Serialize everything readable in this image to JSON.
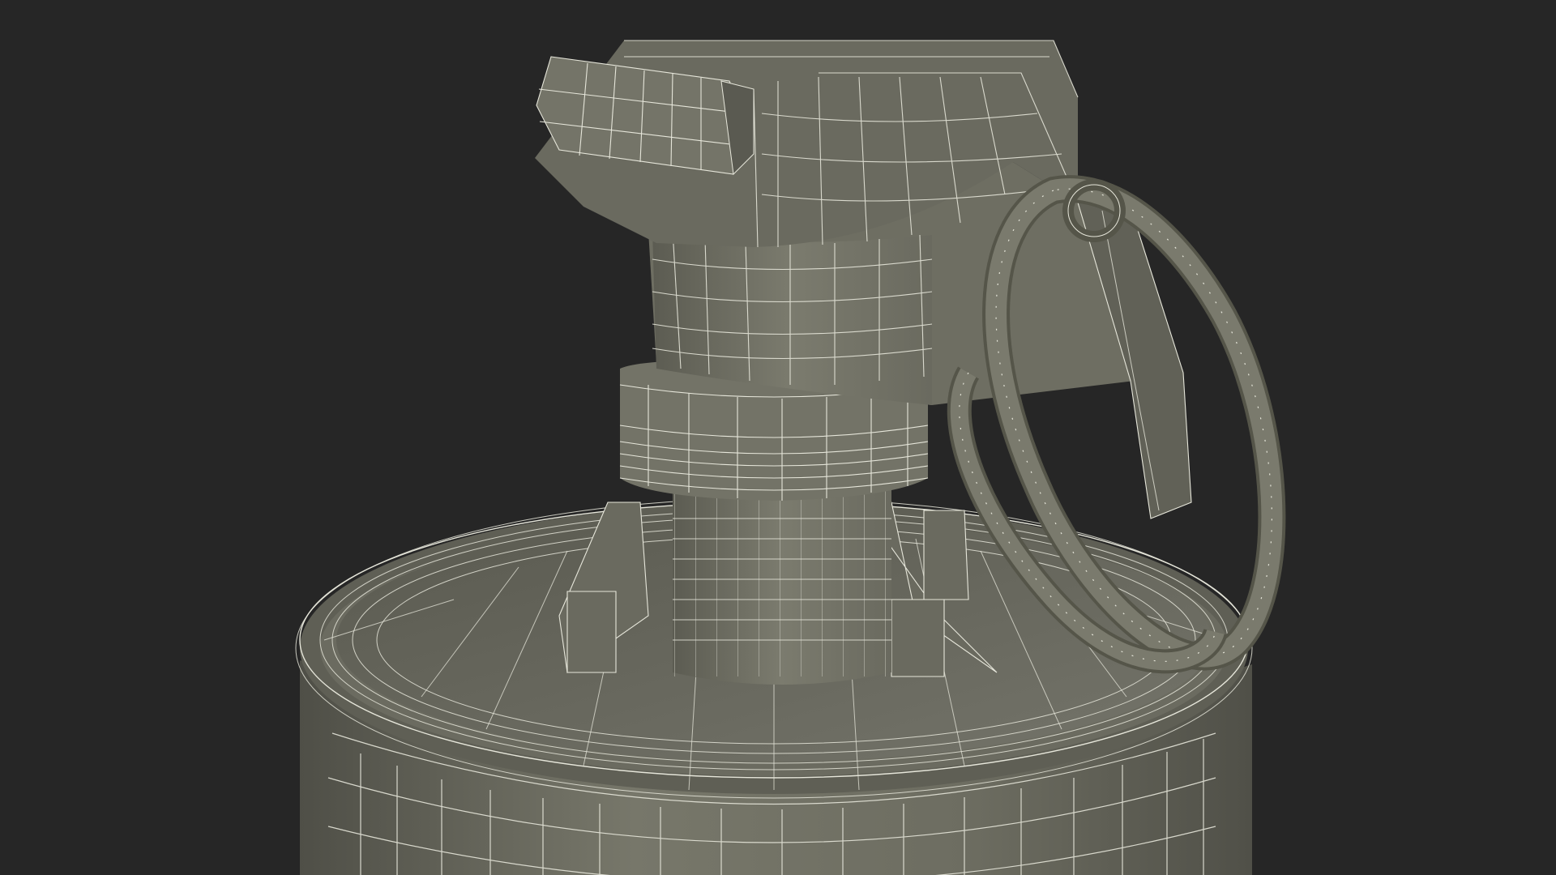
{
  "scene": {
    "subject": "grenade-wireframe-model",
    "colors": {
      "background": "#262626",
      "surface_base": "#6f6f63",
      "surface_light": "#8b8b7d",
      "surface_shadow": "#4c4c44",
      "wire": "#e6e6da"
    }
  }
}
